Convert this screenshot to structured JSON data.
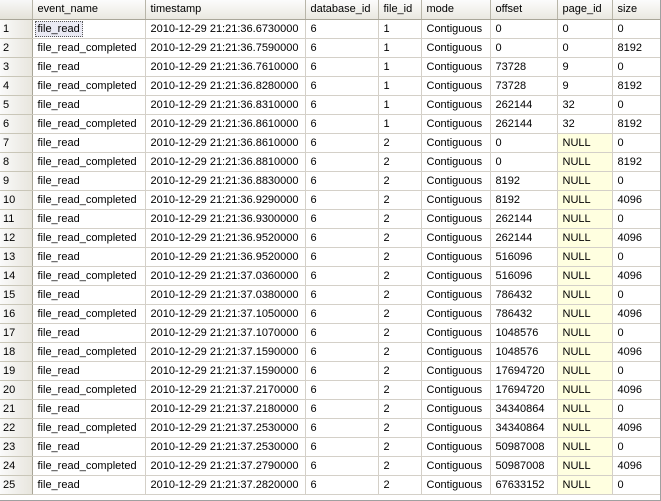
{
  "columns": [
    {
      "key": "event_name",
      "label": "event_name"
    },
    {
      "key": "timestamp",
      "label": "timestamp"
    },
    {
      "key": "database_id",
      "label": "database_id"
    },
    {
      "key": "file_id",
      "label": "file_id"
    },
    {
      "key": "mode",
      "label": "mode"
    },
    {
      "key": "offset",
      "label": "offset"
    },
    {
      "key": "page_id",
      "label": "page_id"
    },
    {
      "key": "size",
      "label": "size"
    }
  ],
  "rows": [
    {
      "n": "1",
      "event_name": "file_read",
      "timestamp": "2010-12-29 21:21:36.6730000",
      "database_id": "6",
      "file_id": "1",
      "mode": "Contiguous",
      "offset": "0",
      "page_id": "0",
      "size": "0"
    },
    {
      "n": "2",
      "event_name": "file_read_completed",
      "timestamp": "2010-12-29 21:21:36.7590000",
      "database_id": "6",
      "file_id": "1",
      "mode": "Contiguous",
      "offset": "0",
      "page_id": "0",
      "size": "8192"
    },
    {
      "n": "3",
      "event_name": "file_read",
      "timestamp": "2010-12-29 21:21:36.7610000",
      "database_id": "6",
      "file_id": "1",
      "mode": "Contiguous",
      "offset": "73728",
      "page_id": "9",
      "size": "0"
    },
    {
      "n": "4",
      "event_name": "file_read_completed",
      "timestamp": "2010-12-29 21:21:36.8280000",
      "database_id": "6",
      "file_id": "1",
      "mode": "Contiguous",
      "offset": "73728",
      "page_id": "9",
      "size": "8192"
    },
    {
      "n": "5",
      "event_name": "file_read",
      "timestamp": "2010-12-29 21:21:36.8310000",
      "database_id": "6",
      "file_id": "1",
      "mode": "Contiguous",
      "offset": "262144",
      "page_id": "32",
      "size": "0"
    },
    {
      "n": "6",
      "event_name": "file_read_completed",
      "timestamp": "2010-12-29 21:21:36.8610000",
      "database_id": "6",
      "file_id": "1",
      "mode": "Contiguous",
      "offset": "262144",
      "page_id": "32",
      "size": "8192"
    },
    {
      "n": "7",
      "event_name": "file_read",
      "timestamp": "2010-12-29 21:21:36.8610000",
      "database_id": "6",
      "file_id": "2",
      "mode": "Contiguous",
      "offset": "0",
      "page_id": "NULL",
      "size": "0"
    },
    {
      "n": "8",
      "event_name": "file_read_completed",
      "timestamp": "2010-12-29 21:21:36.8810000",
      "database_id": "6",
      "file_id": "2",
      "mode": "Contiguous",
      "offset": "0",
      "page_id": "NULL",
      "size": "8192"
    },
    {
      "n": "9",
      "event_name": "file_read",
      "timestamp": "2010-12-29 21:21:36.8830000",
      "database_id": "6",
      "file_id": "2",
      "mode": "Contiguous",
      "offset": "8192",
      "page_id": "NULL",
      "size": "0"
    },
    {
      "n": "10",
      "event_name": "file_read_completed",
      "timestamp": "2010-12-29 21:21:36.9290000",
      "database_id": "6",
      "file_id": "2",
      "mode": "Contiguous",
      "offset": "8192",
      "page_id": "NULL",
      "size": "4096"
    },
    {
      "n": "11",
      "event_name": "file_read",
      "timestamp": "2010-12-29 21:21:36.9300000",
      "database_id": "6",
      "file_id": "2",
      "mode": "Contiguous",
      "offset": "262144",
      "page_id": "NULL",
      "size": "0"
    },
    {
      "n": "12",
      "event_name": "file_read_completed",
      "timestamp": "2010-12-29 21:21:36.9520000",
      "database_id": "6",
      "file_id": "2",
      "mode": "Contiguous",
      "offset": "262144",
      "page_id": "NULL",
      "size": "4096"
    },
    {
      "n": "13",
      "event_name": "file_read",
      "timestamp": "2010-12-29 21:21:36.9520000",
      "database_id": "6",
      "file_id": "2",
      "mode": "Contiguous",
      "offset": "516096",
      "page_id": "NULL",
      "size": "0"
    },
    {
      "n": "14",
      "event_name": "file_read_completed",
      "timestamp": "2010-12-29 21:21:37.0360000",
      "database_id": "6",
      "file_id": "2",
      "mode": "Contiguous",
      "offset": "516096",
      "page_id": "NULL",
      "size": "4096"
    },
    {
      "n": "15",
      "event_name": "file_read",
      "timestamp": "2010-12-29 21:21:37.0380000",
      "database_id": "6",
      "file_id": "2",
      "mode": "Contiguous",
      "offset": "786432",
      "page_id": "NULL",
      "size": "0"
    },
    {
      "n": "16",
      "event_name": "file_read_completed",
      "timestamp": "2010-12-29 21:21:37.1050000",
      "database_id": "6",
      "file_id": "2",
      "mode": "Contiguous",
      "offset": "786432",
      "page_id": "NULL",
      "size": "4096"
    },
    {
      "n": "17",
      "event_name": "file_read",
      "timestamp": "2010-12-29 21:21:37.1070000",
      "database_id": "6",
      "file_id": "2",
      "mode": "Contiguous",
      "offset": "1048576",
      "page_id": "NULL",
      "size": "0"
    },
    {
      "n": "18",
      "event_name": "file_read_completed",
      "timestamp": "2010-12-29 21:21:37.1590000",
      "database_id": "6",
      "file_id": "2",
      "mode": "Contiguous",
      "offset": "1048576",
      "page_id": "NULL",
      "size": "4096"
    },
    {
      "n": "19",
      "event_name": "file_read",
      "timestamp": "2010-12-29 21:21:37.1590000",
      "database_id": "6",
      "file_id": "2",
      "mode": "Contiguous",
      "offset": "17694720",
      "page_id": "NULL",
      "size": "0"
    },
    {
      "n": "20",
      "event_name": "file_read_completed",
      "timestamp": "2010-12-29 21:21:37.2170000",
      "database_id": "6",
      "file_id": "2",
      "mode": "Contiguous",
      "offset": "17694720",
      "page_id": "NULL",
      "size": "4096"
    },
    {
      "n": "21",
      "event_name": "file_read",
      "timestamp": "2010-12-29 21:21:37.2180000",
      "database_id": "6",
      "file_id": "2",
      "mode": "Contiguous",
      "offset": "34340864",
      "page_id": "NULL",
      "size": "0"
    },
    {
      "n": "22",
      "event_name": "file_read_completed",
      "timestamp": "2010-12-29 21:21:37.2530000",
      "database_id": "6",
      "file_id": "2",
      "mode": "Contiguous",
      "offset": "34340864",
      "page_id": "NULL",
      "size": "4096"
    },
    {
      "n": "23",
      "event_name": "file_read",
      "timestamp": "2010-12-29 21:21:37.2530000",
      "database_id": "6",
      "file_id": "2",
      "mode": "Contiguous",
      "offset": "50987008",
      "page_id": "NULL",
      "size": "0"
    },
    {
      "n": "24",
      "event_name": "file_read_completed",
      "timestamp": "2010-12-29 21:21:37.2790000",
      "database_id": "6",
      "file_id": "2",
      "mode": "Contiguous",
      "offset": "50987008",
      "page_id": "NULL",
      "size": "4096"
    },
    {
      "n": "25",
      "event_name": "file_read",
      "timestamp": "2010-12-29 21:21:37.2820000",
      "database_id": "6",
      "file_id": "2",
      "mode": "Contiguous",
      "offset": "67633152",
      "page_id": "NULL",
      "size": "0"
    }
  ],
  "null_text": "NULL",
  "selected_cell": {
    "row": 1,
    "column": "event_name"
  },
  "colors": {
    "null_cell_background": "#ffffe0",
    "header_background": "#eae8e0",
    "grid_line": "#d4d0c8"
  }
}
